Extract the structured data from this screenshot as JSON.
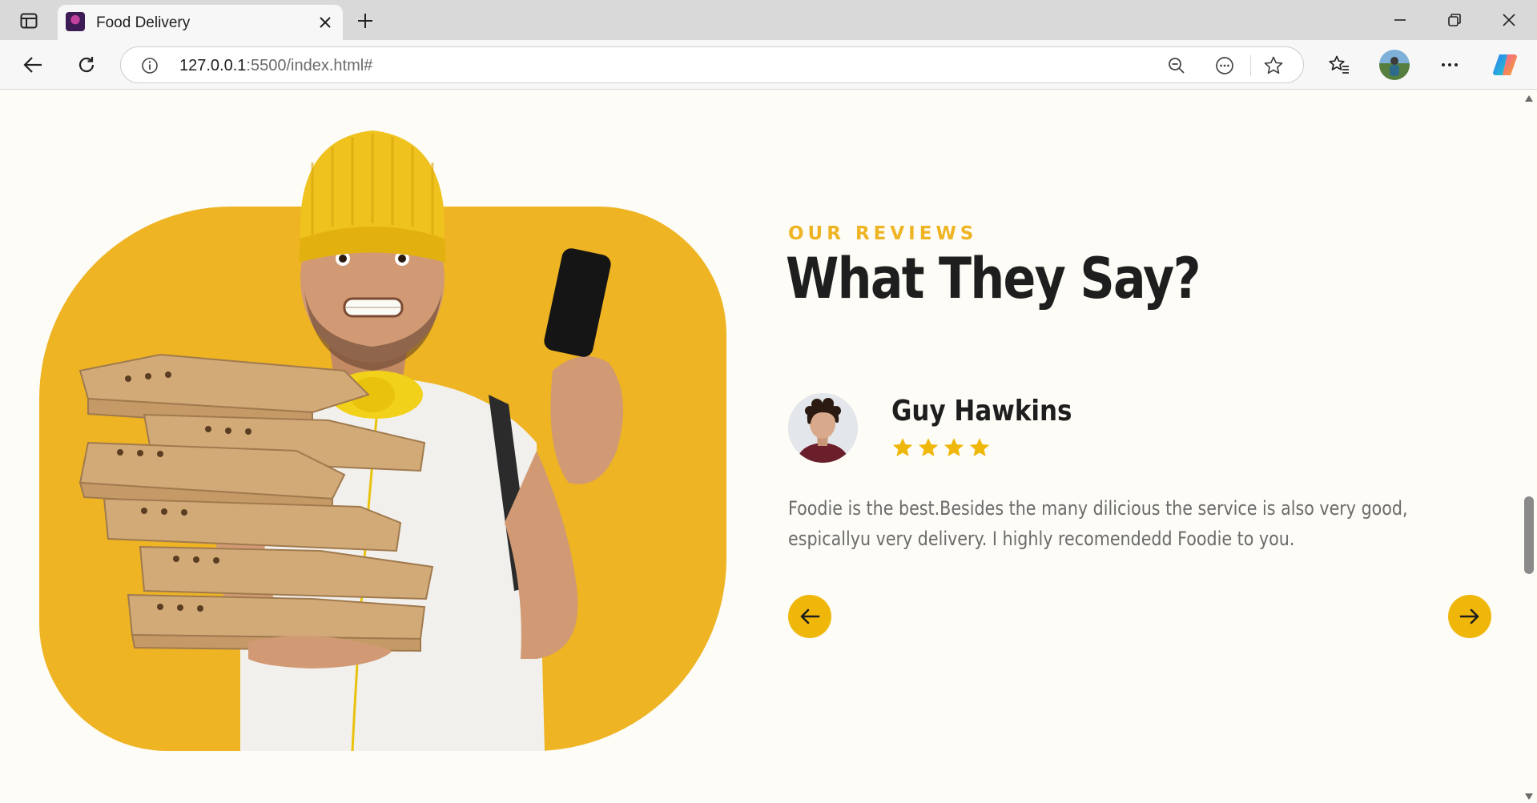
{
  "browser": {
    "tab_title": "Food Delivery",
    "url_host": "127.0.0.1",
    "url_rest": ":5500/index.html#"
  },
  "section": {
    "kicker": "OUR REVIEWS",
    "title": "What They Say?"
  },
  "review": {
    "name": "Guy Hawkins",
    "rating": 4,
    "text": "Foodie is the best.Besides the many dilicious the service is also very good, espicallyu very delivery. I highly recomendedd Foodie to you."
  },
  "colors": {
    "accent": "#eeb423",
    "button": "#f0b70b",
    "heading": "#1e1e1e",
    "body_text": "#6b6b6b",
    "background": "#fdfcf7"
  }
}
